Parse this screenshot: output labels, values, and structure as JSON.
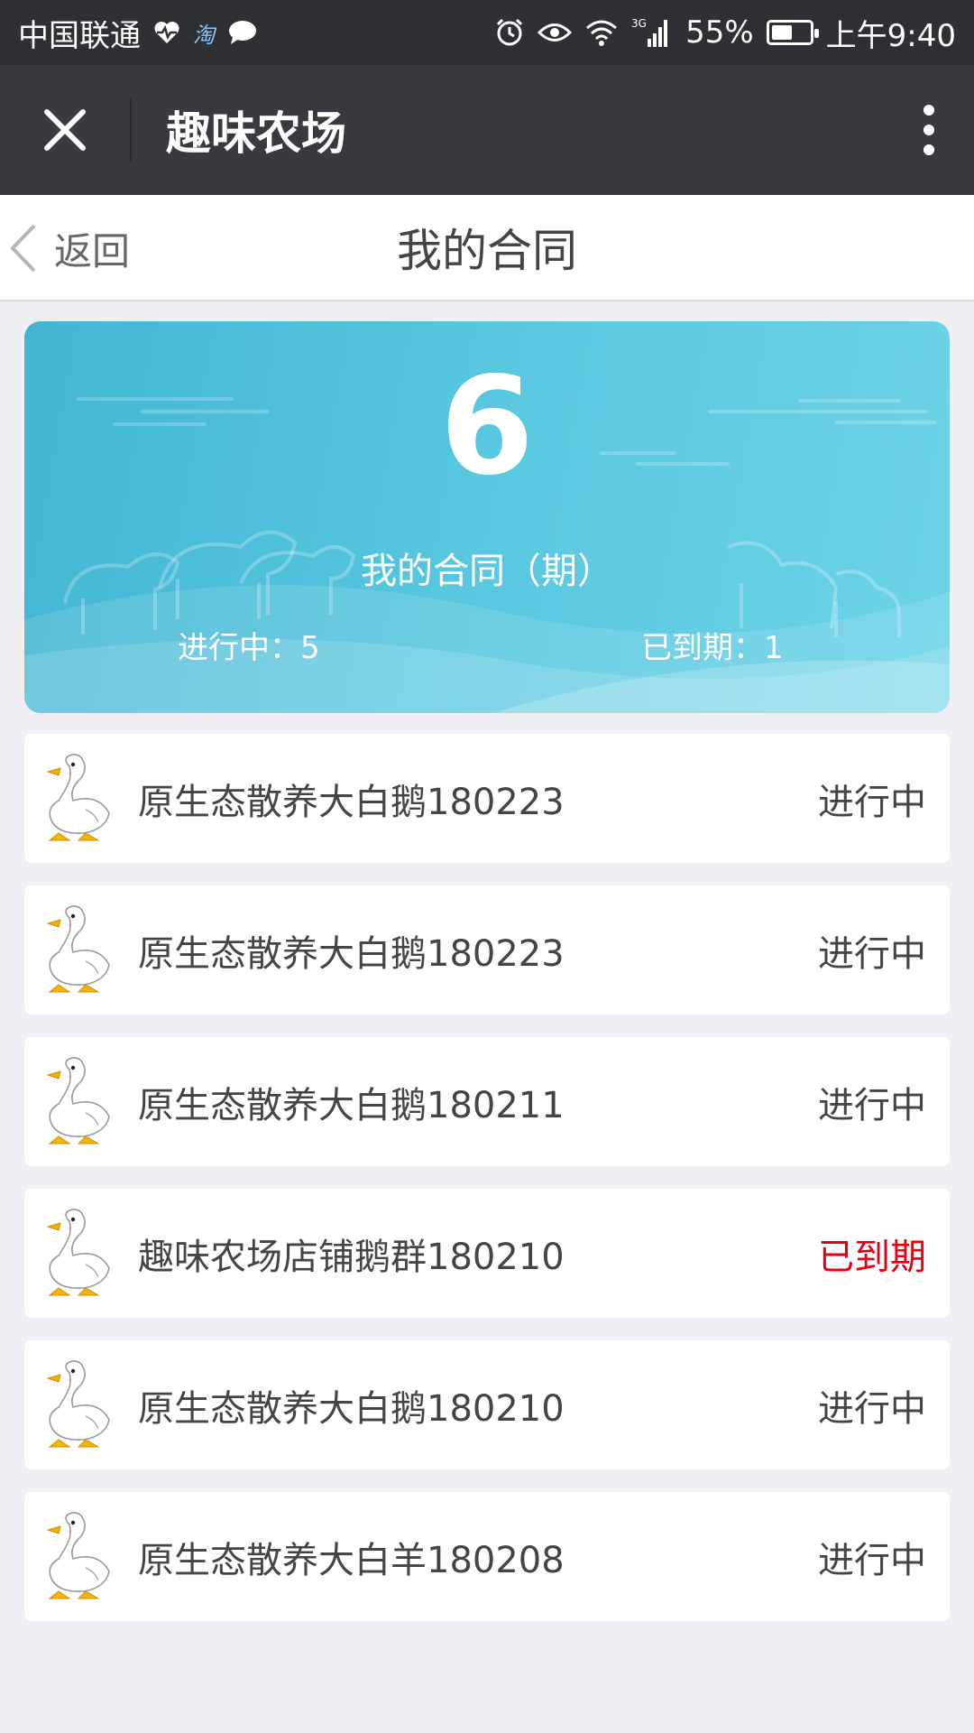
{
  "status_bar": {
    "carrier": "中国联通",
    "taobao_label": "淘",
    "network": "3G",
    "battery": "55%",
    "battery_level": 0.55,
    "time": "上午9:40"
  },
  "title_bar": {
    "title": "趣味农场"
  },
  "page_nav": {
    "back_label": "返回",
    "title": "我的合同"
  },
  "summary": {
    "total": "6",
    "label": "我的合同（期）",
    "active_text": "进行中：5",
    "expired_text": "已到期：1"
  },
  "contracts": [
    {
      "name": "原生态散养大白鹅180223",
      "status": "进行中"
    },
    {
      "name": "原生态散养大白鹅180223",
      "status": "进行中"
    },
    {
      "name": "原生态散养大白鹅180211",
      "status": "进行中"
    },
    {
      "name": "趣味农场店铺鹅群180210",
      "status": "已到期"
    },
    {
      "name": "原生态散养大白鹅180210",
      "status": "进行中"
    },
    {
      "name": "原生态散养大白羊180208",
      "status": "进行中"
    }
  ],
  "colors": {
    "status_active": "#444444",
    "status_expired": "#e60012",
    "card_gradient_start": "#41b6d3",
    "card_gradient_end": "#6dd3e8"
  },
  "icons": {
    "close": "close-icon",
    "more": "more-vertical-icon",
    "back": "chevron-left-icon",
    "item": "goose-icon"
  }
}
